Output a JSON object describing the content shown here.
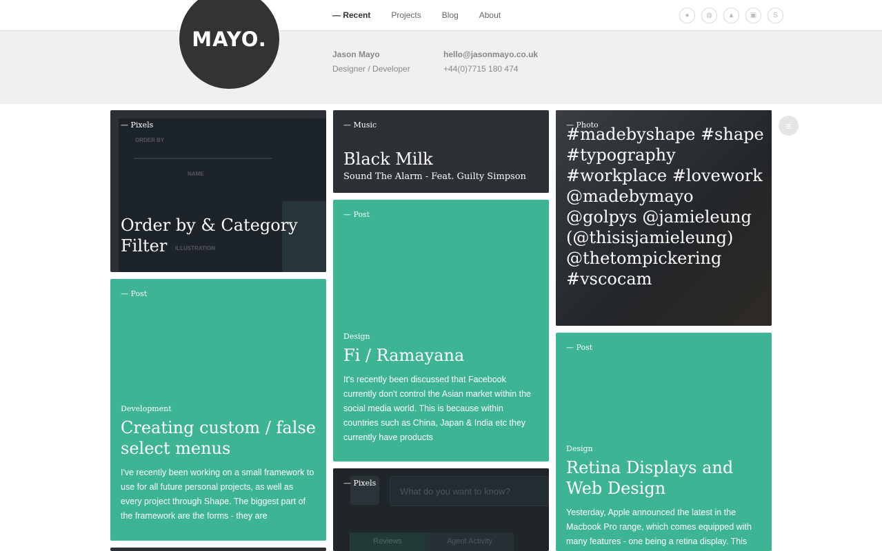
{
  "logo": {
    "text": "MAYO."
  },
  "nav": {
    "items": [
      "— Recent",
      "Projects",
      "Blog",
      "About"
    ]
  },
  "social": {
    "icons": [
      "twitter-icon",
      "dribbble-icon",
      "forrst-icon",
      "instagram-icon",
      "skype-icon"
    ]
  },
  "contact": {
    "name": "Jason Mayo",
    "role": "Designer / Developer",
    "email": "hello@jasonmayo.co.uk",
    "phone": "+44(0)7715 180 474"
  },
  "cards": {
    "c1": {
      "tag": "— Pixels",
      "title": "Order by & Category Filter",
      "bg_labels": [
        "ORDER BY",
        "NAME",
        "ILLUSTRATION"
      ]
    },
    "c2": {
      "tag": "— Post",
      "category": "Development",
      "title": "Creating custom / false select menus",
      "excerpt": "I've recently been working on a small framework to use for all future personal projects, as well as every project through Shape. The biggest part of the framework are the forms - they are"
    },
    "c3": {
      "tag": "— Music",
      "title": "Black Milk",
      "subtitle": "Sound The Alarm - Feat. Guilty Simpson"
    },
    "c4": {
      "tag": "— Post",
      "category": "Design",
      "title": "Fi / Ramayana",
      "excerpt": "It's recently been discussed that Facebook currently don't control the Asian market within the social media world. This is because within countries such as China, Japan & India etc they currently have products"
    },
    "c5": {
      "tag": "— Pixels",
      "placeholder": "What do you want to know?",
      "tab1": "Reviews",
      "tab2": "Agent Activity"
    },
    "c6": {
      "tag": "— Photo",
      "caption": "#madebyshape #shape #typography #workplace #lovework @madebymayo @golpys @jamieleung (@thisisjamieleung) @thetompickering #vscocam"
    },
    "c7": {
      "tag": "— Post",
      "category": "Design",
      "title": "Retina Displays and Web Design",
      "excerpt": "Yesterday, Apple announced the latest in the Macbook Pro range, which comes equipped with many features - one being a retina display. This"
    }
  },
  "colors": {
    "green": "#3db594",
    "dark": "#2d3035"
  }
}
